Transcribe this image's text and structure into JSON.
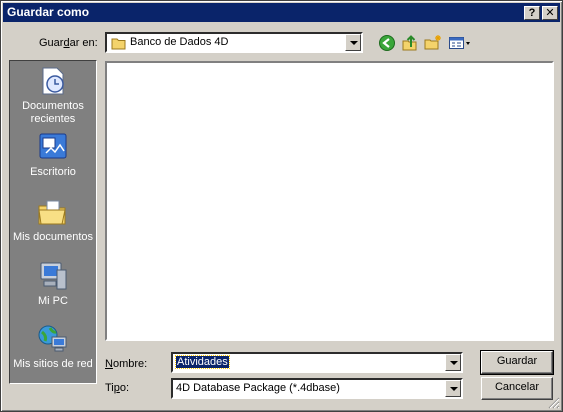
{
  "window": {
    "title": "Guardar como",
    "help_button": "?",
    "close_button": "✕"
  },
  "lookin": {
    "label_pre": "Guar",
    "label_key": "d",
    "label_post": "ar en:",
    "value": "Banco de Dados 4D"
  },
  "toolbar": {
    "back_icon": "back-arrow-icon",
    "up_icon": "up-folder-icon",
    "new_folder_icon": "new-folder-icon",
    "view_icon": "views-menu-icon"
  },
  "places": [
    {
      "label": "Documentos recientes",
      "icon": "recent-documents-icon"
    },
    {
      "label": "Escritorio",
      "icon": "desktop-icon"
    },
    {
      "label": "Mis documentos",
      "icon": "my-documents-icon"
    },
    {
      "label": "Mi PC",
      "icon": "my-computer-icon"
    },
    {
      "label": "Mis sitios de red",
      "icon": "network-places-icon"
    }
  ],
  "filename": {
    "label_key": "N",
    "label_post": "ombre:",
    "value": "Atividades"
  },
  "filetype": {
    "label_pre": "Ti",
    "label_key": "p",
    "label_post": "o:",
    "value": "4D Database Package (*.4dbase)"
  },
  "buttons": {
    "save": "Guardar",
    "cancel": "Cancelar"
  }
}
